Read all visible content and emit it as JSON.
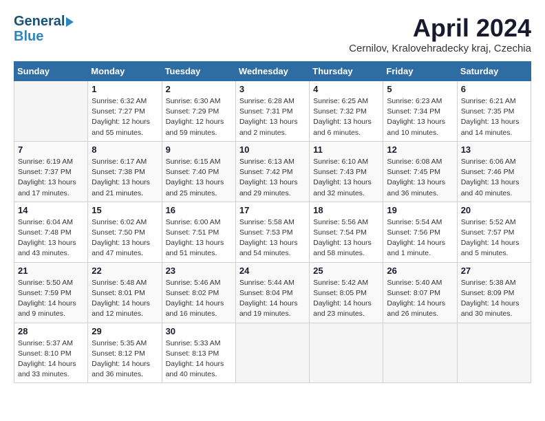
{
  "header": {
    "logo_line1": "General",
    "logo_line2": "Blue",
    "title": "April 2024",
    "subtitle": "Cernilov, Kralovehradecky kraj, Czechia"
  },
  "calendar": {
    "headers": [
      "Sunday",
      "Monday",
      "Tuesday",
      "Wednesday",
      "Thursday",
      "Friday",
      "Saturday"
    ],
    "weeks": [
      [
        {
          "day": "",
          "info": ""
        },
        {
          "day": "1",
          "info": "Sunrise: 6:32 AM\nSunset: 7:27 PM\nDaylight: 12 hours\nand 55 minutes."
        },
        {
          "day": "2",
          "info": "Sunrise: 6:30 AM\nSunset: 7:29 PM\nDaylight: 12 hours\nand 59 minutes."
        },
        {
          "day": "3",
          "info": "Sunrise: 6:28 AM\nSunset: 7:31 PM\nDaylight: 13 hours\nand 2 minutes."
        },
        {
          "day": "4",
          "info": "Sunrise: 6:25 AM\nSunset: 7:32 PM\nDaylight: 13 hours\nand 6 minutes."
        },
        {
          "day": "5",
          "info": "Sunrise: 6:23 AM\nSunset: 7:34 PM\nDaylight: 13 hours\nand 10 minutes."
        },
        {
          "day": "6",
          "info": "Sunrise: 6:21 AM\nSunset: 7:35 PM\nDaylight: 13 hours\nand 14 minutes."
        }
      ],
      [
        {
          "day": "7",
          "info": "Sunrise: 6:19 AM\nSunset: 7:37 PM\nDaylight: 13 hours\nand 17 minutes."
        },
        {
          "day": "8",
          "info": "Sunrise: 6:17 AM\nSunset: 7:38 PM\nDaylight: 13 hours\nand 21 minutes."
        },
        {
          "day": "9",
          "info": "Sunrise: 6:15 AM\nSunset: 7:40 PM\nDaylight: 13 hours\nand 25 minutes."
        },
        {
          "day": "10",
          "info": "Sunrise: 6:13 AM\nSunset: 7:42 PM\nDaylight: 13 hours\nand 29 minutes."
        },
        {
          "day": "11",
          "info": "Sunrise: 6:10 AM\nSunset: 7:43 PM\nDaylight: 13 hours\nand 32 minutes."
        },
        {
          "day": "12",
          "info": "Sunrise: 6:08 AM\nSunset: 7:45 PM\nDaylight: 13 hours\nand 36 minutes."
        },
        {
          "day": "13",
          "info": "Sunrise: 6:06 AM\nSunset: 7:46 PM\nDaylight: 13 hours\nand 40 minutes."
        }
      ],
      [
        {
          "day": "14",
          "info": "Sunrise: 6:04 AM\nSunset: 7:48 PM\nDaylight: 13 hours\nand 43 minutes."
        },
        {
          "day": "15",
          "info": "Sunrise: 6:02 AM\nSunset: 7:50 PM\nDaylight: 13 hours\nand 47 minutes."
        },
        {
          "day": "16",
          "info": "Sunrise: 6:00 AM\nSunset: 7:51 PM\nDaylight: 13 hours\nand 51 minutes."
        },
        {
          "day": "17",
          "info": "Sunrise: 5:58 AM\nSunset: 7:53 PM\nDaylight: 13 hours\nand 54 minutes."
        },
        {
          "day": "18",
          "info": "Sunrise: 5:56 AM\nSunset: 7:54 PM\nDaylight: 13 hours\nand 58 minutes."
        },
        {
          "day": "19",
          "info": "Sunrise: 5:54 AM\nSunset: 7:56 PM\nDaylight: 14 hours\nand 1 minute."
        },
        {
          "day": "20",
          "info": "Sunrise: 5:52 AM\nSunset: 7:57 PM\nDaylight: 14 hours\nand 5 minutes."
        }
      ],
      [
        {
          "day": "21",
          "info": "Sunrise: 5:50 AM\nSunset: 7:59 PM\nDaylight: 14 hours\nand 9 minutes."
        },
        {
          "day": "22",
          "info": "Sunrise: 5:48 AM\nSunset: 8:01 PM\nDaylight: 14 hours\nand 12 minutes."
        },
        {
          "day": "23",
          "info": "Sunrise: 5:46 AM\nSunset: 8:02 PM\nDaylight: 14 hours\nand 16 minutes."
        },
        {
          "day": "24",
          "info": "Sunrise: 5:44 AM\nSunset: 8:04 PM\nDaylight: 14 hours\nand 19 minutes."
        },
        {
          "day": "25",
          "info": "Sunrise: 5:42 AM\nSunset: 8:05 PM\nDaylight: 14 hours\nand 23 minutes."
        },
        {
          "day": "26",
          "info": "Sunrise: 5:40 AM\nSunset: 8:07 PM\nDaylight: 14 hours\nand 26 minutes."
        },
        {
          "day": "27",
          "info": "Sunrise: 5:38 AM\nSunset: 8:09 PM\nDaylight: 14 hours\nand 30 minutes."
        }
      ],
      [
        {
          "day": "28",
          "info": "Sunrise: 5:37 AM\nSunset: 8:10 PM\nDaylight: 14 hours\nand 33 minutes."
        },
        {
          "day": "29",
          "info": "Sunrise: 5:35 AM\nSunset: 8:12 PM\nDaylight: 14 hours\nand 36 minutes."
        },
        {
          "day": "30",
          "info": "Sunrise: 5:33 AM\nSunset: 8:13 PM\nDaylight: 14 hours\nand 40 minutes."
        },
        {
          "day": "",
          "info": ""
        },
        {
          "day": "",
          "info": ""
        },
        {
          "day": "",
          "info": ""
        },
        {
          "day": "",
          "info": ""
        }
      ]
    ]
  }
}
